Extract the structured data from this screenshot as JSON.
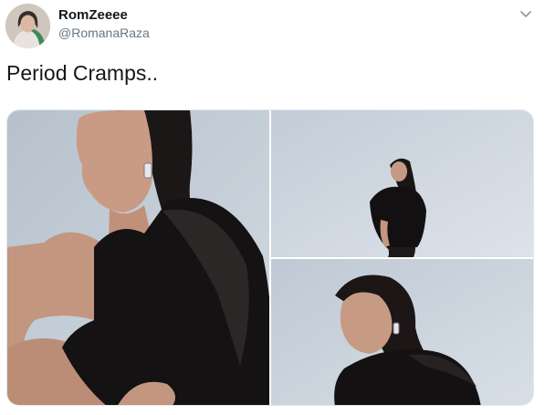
{
  "tweet": {
    "author": {
      "display_name": "RomZeeee",
      "handle": "@RomanaRaza",
      "avatar_icon": "avatar-photo"
    },
    "menu_icon": "chevron-down-icon",
    "text": "Period Cramps..",
    "media": {
      "photo_count": 3
    }
  },
  "colors": {
    "name": "#14171a",
    "handle": "#657786",
    "background_studio": "#c7d1dc",
    "dress": "#111111"
  }
}
